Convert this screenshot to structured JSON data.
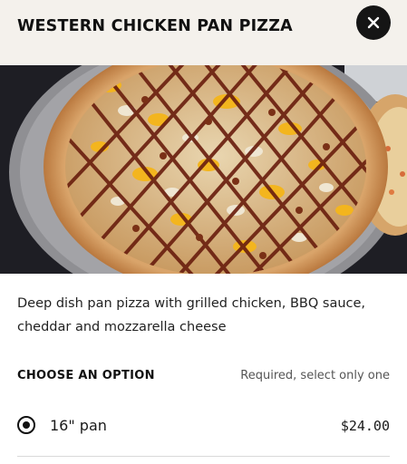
{
  "header": {
    "title": "WESTERN CHICKEN PAN PIZZA",
    "close_icon": "close-icon"
  },
  "hero_image": {
    "subject": "pizza photo"
  },
  "description": "Deep dish pan pizza with grilled chicken, BBQ sauce, cheddar and mozzarella cheese",
  "options": {
    "heading": "CHOOSE AN OPTION",
    "note": "Required, select only one",
    "items": [
      {
        "label": "16\" pan",
        "price": "$24.00",
        "selected": true
      }
    ]
  },
  "colors": {
    "header_bg": "#f4f1ec",
    "accent": "#151515"
  }
}
